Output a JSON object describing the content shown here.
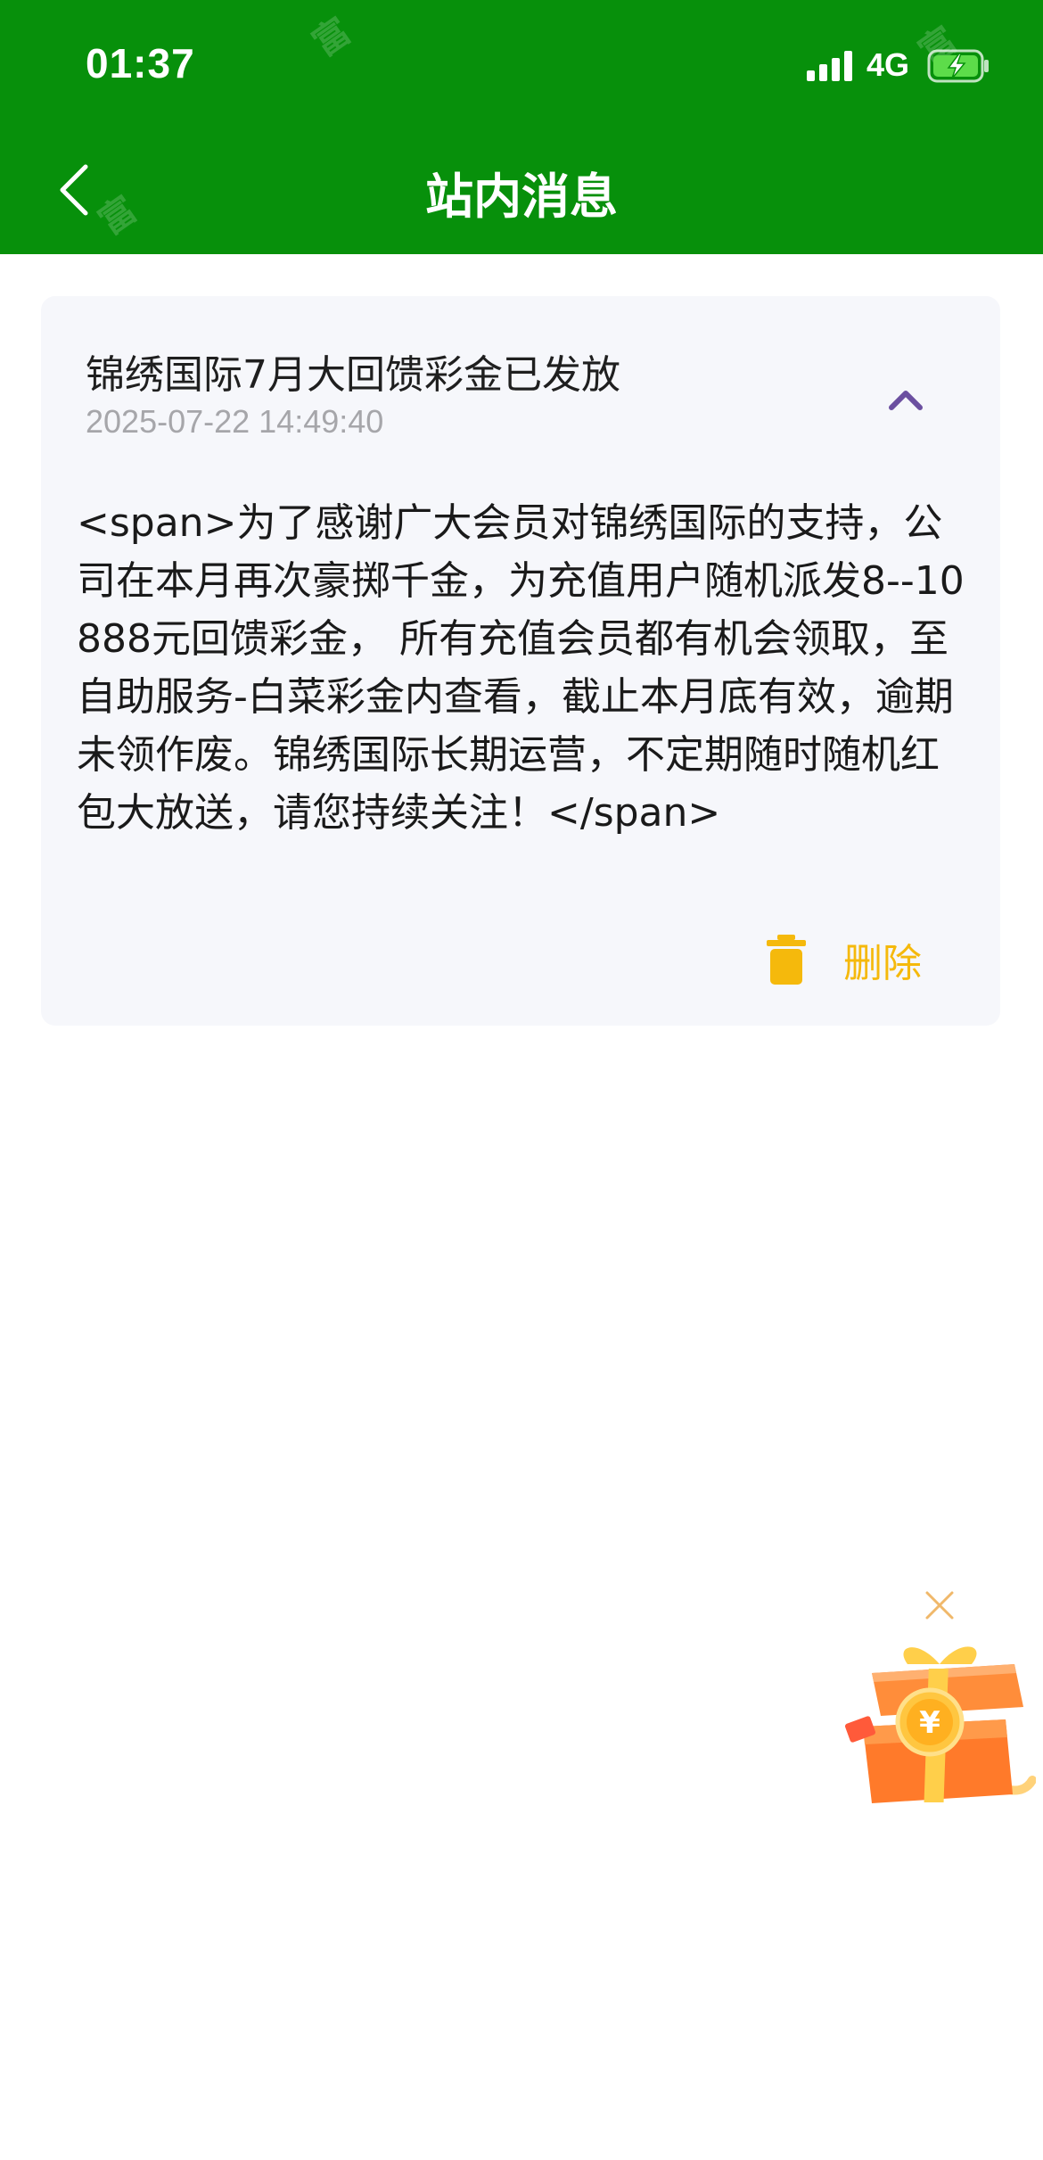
{
  "status_bar": {
    "time": "01:37",
    "network": "4G",
    "signal_icon": "signal-bars-icon",
    "battery_icon": "battery-charging-icon"
  },
  "header": {
    "title": "站内消息",
    "back_icon": "chevron-left-icon",
    "background_color": "#07900b"
  },
  "message": {
    "title": "锦绣国际7月大回馈彩金已发放",
    "timestamp": "2025-07-22 14:49:40",
    "body": "<span>为了感谢广大会员对锦绣国际的支持，公司在本月再次豪掷千金，为充值用户随机派发8--10888元回馈彩金， 所有充值会员都有机会领取，至自助服务-白菜彩金内查看，截止本月底有效，逾期未领作废。锦绣国际长期运营，不定期随时随机红包大放送，请您持续关注！</span>",
    "collapse_icon": "chevron-up-icon",
    "delete_label": "删除",
    "delete_icon": "trash-icon",
    "accent_color": "#f5b90c",
    "chevron_color": "#6b4fa0"
  },
  "floating_widget": {
    "close_icon": "close-icon",
    "gift_icon": "gift-box-icon"
  }
}
